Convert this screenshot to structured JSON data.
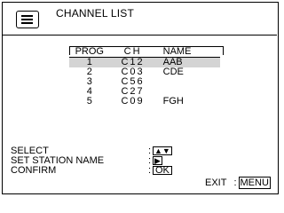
{
  "header": {
    "title": "CHANNEL LIST",
    "icon": "list-menu-icon"
  },
  "table": {
    "columns": [
      "PROG",
      "CH",
      "NAME"
    ],
    "rows": [
      {
        "prog": "1",
        "ch": "C12",
        "name": "AAB",
        "selected": true
      },
      {
        "prog": "2",
        "ch": "C03",
        "name": "CDE",
        "selected": false
      },
      {
        "prog": "3",
        "ch": "C56",
        "name": "",
        "selected": false
      },
      {
        "prog": "4",
        "ch": "C27",
        "name": "",
        "selected": false
      },
      {
        "prog": "5",
        "ch": "C09",
        "name": "FGH",
        "selected": false
      }
    ]
  },
  "legend": {
    "select": {
      "label": "SELECT",
      "key": "▲▼"
    },
    "set_name": {
      "label": "SET STATION NAME",
      "key": "▶"
    },
    "confirm": {
      "label": "CONFIRM",
      "key": "OK"
    }
  },
  "footer": {
    "exit_label": "EXIT",
    "menu_key": "MENU"
  },
  "colors": {
    "selection": "#d4d4d4",
    "border": "#000000"
  }
}
